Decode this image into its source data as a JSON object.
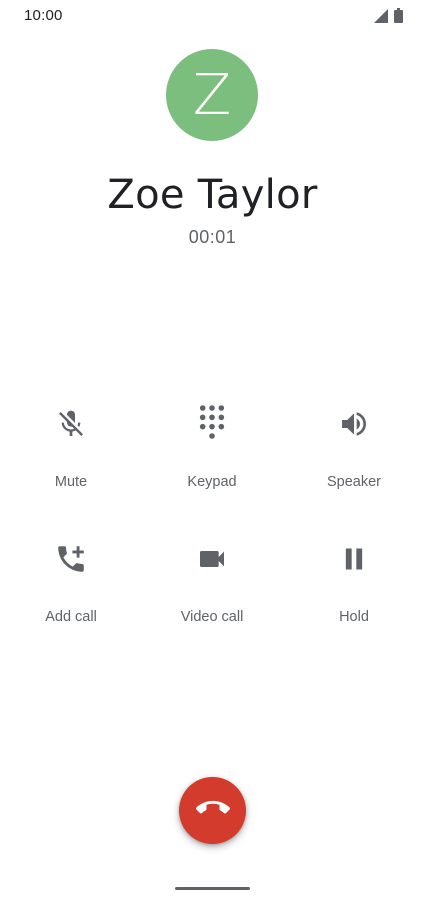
{
  "status_bar": {
    "time": "10:00",
    "icons": [
      "signal-icon",
      "battery-icon"
    ]
  },
  "contact": {
    "initial": "Z",
    "name": "Zoe Taylor",
    "avatar_color": "#7cbe7e"
  },
  "call": {
    "timer": "00:01"
  },
  "controls": {
    "mute": {
      "label": "Mute",
      "icon": "mic-off-icon"
    },
    "keypad": {
      "label": "Keypad",
      "icon": "dialpad-icon"
    },
    "speaker": {
      "label": "Speaker",
      "icon": "speaker-icon"
    },
    "add_call": {
      "label": "Add call",
      "icon": "add-call-icon"
    },
    "video_call": {
      "label": "Video call",
      "icon": "video-camera-icon"
    },
    "hold": {
      "label": "Hold",
      "icon": "pause-icon"
    }
  },
  "end_call": {
    "icon": "call-end-icon",
    "color": "#d33c2d"
  },
  "colors": {
    "icon_gray": "#5f6368",
    "text_dark": "#202124"
  }
}
